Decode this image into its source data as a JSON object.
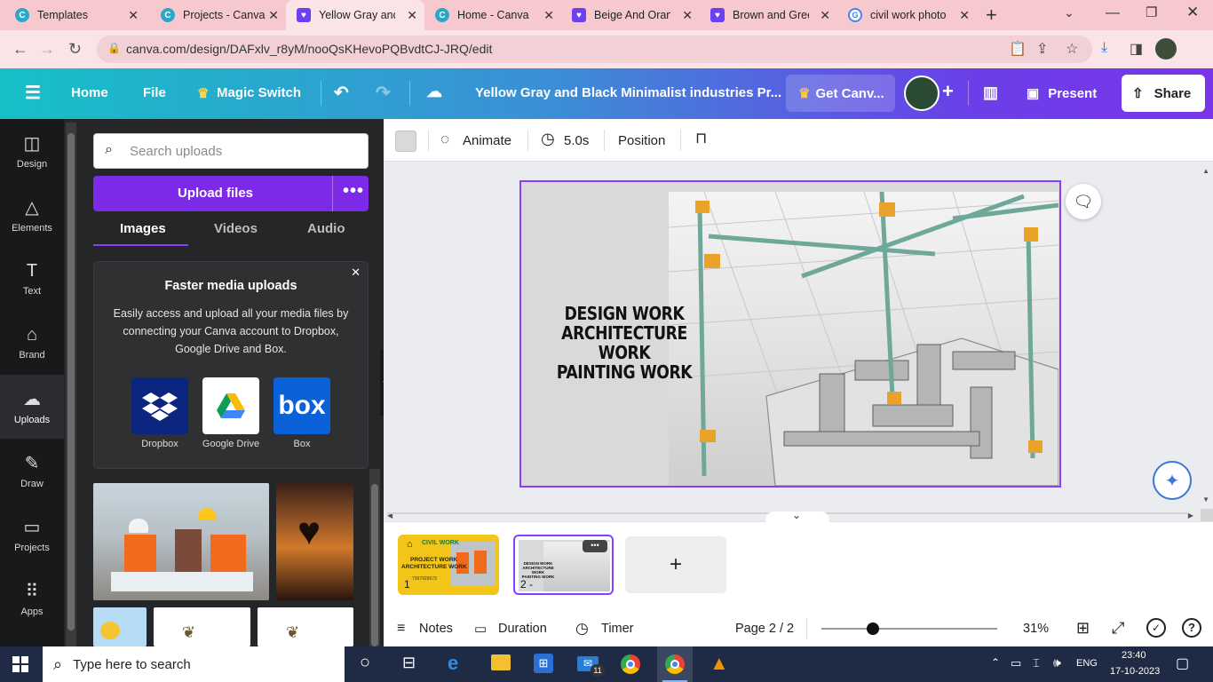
{
  "browser": {
    "tabs": [
      {
        "title": "Templates",
        "icon": "canva-icon"
      },
      {
        "title": "Projects - Canva",
        "icon": "canva-icon"
      },
      {
        "title": "Yellow Gray and",
        "icon": "canva-heart-icon",
        "active": true
      },
      {
        "title": "Home - Canva",
        "icon": "canva-icon"
      },
      {
        "title": "Beige And Oran",
        "icon": "canva-heart-icon"
      },
      {
        "title": "Brown and Gree",
        "icon": "canva-heart-icon"
      },
      {
        "title": "civil work photo",
        "icon": "google-icon"
      }
    ],
    "url": "canva.com/design/DAFxlv_r8yM/nooQsKHevoPQBvdtCJ-JRQ/edit"
  },
  "topbar": {
    "menu_icon": "hamburger-icon",
    "home": "Home",
    "file": "File",
    "magic_switch": "Magic Switch",
    "title": "Yellow Gray and Black Minimalist industries Pr...",
    "get_canva": "Get Canv...",
    "present": "Present",
    "share": "Share"
  },
  "rail": [
    {
      "label": "Design",
      "icon": "design-icon"
    },
    {
      "label": "Elements",
      "icon": "elements-icon"
    },
    {
      "label": "Text",
      "icon": "text-icon"
    },
    {
      "label": "Brand",
      "icon": "brand-icon"
    },
    {
      "label": "Uploads",
      "icon": "uploads-icon",
      "active": true
    },
    {
      "label": "Draw",
      "icon": "draw-icon"
    },
    {
      "label": "Projects",
      "icon": "projects-icon"
    },
    {
      "label": "Apps",
      "icon": "apps-icon"
    }
  ],
  "panel": {
    "search_placeholder": "Search uploads",
    "upload_button": "Upload files",
    "tabs": [
      "Images",
      "Videos",
      "Audio"
    ],
    "card_title": "Faster media uploads",
    "card_body": "Easily access and upload all your media files by connecting your Canva account to Dropbox, Google Drive and Box.",
    "services": [
      "Dropbox",
      "Google Drive",
      "Box"
    ]
  },
  "toolbar": {
    "animate": "Animate",
    "duration": "5.0s",
    "position": "Position"
  },
  "slide": {
    "lines": [
      "DESIGN WORK",
      "ARCHITECTURE WORK",
      "PAINTING WORK"
    ]
  },
  "pages": [
    {
      "num": "1",
      "mini_title": "CIVIL WORK",
      "mini_lines": [
        "PROJECT WORK",
        "ARCHITECTURE WORK"
      ],
      "mini_phone": "7397929573"
    },
    {
      "num": "2 -",
      "mini_lines": [
        "DESIGN WORK",
        "ARCHITECTURE WORK",
        "PAINTING WORK"
      ]
    }
  ],
  "footer": {
    "notes": "Notes",
    "duration": "Duration",
    "timer": "Timer",
    "page": "Page 2 / 2",
    "zoom": "31%",
    "zoom_level": 0.31
  },
  "taskbar": {
    "search_placeholder": "Type here to search",
    "lang": "ENG",
    "time": "23:40",
    "date": "17-10-2023",
    "mail_badge": "11"
  }
}
